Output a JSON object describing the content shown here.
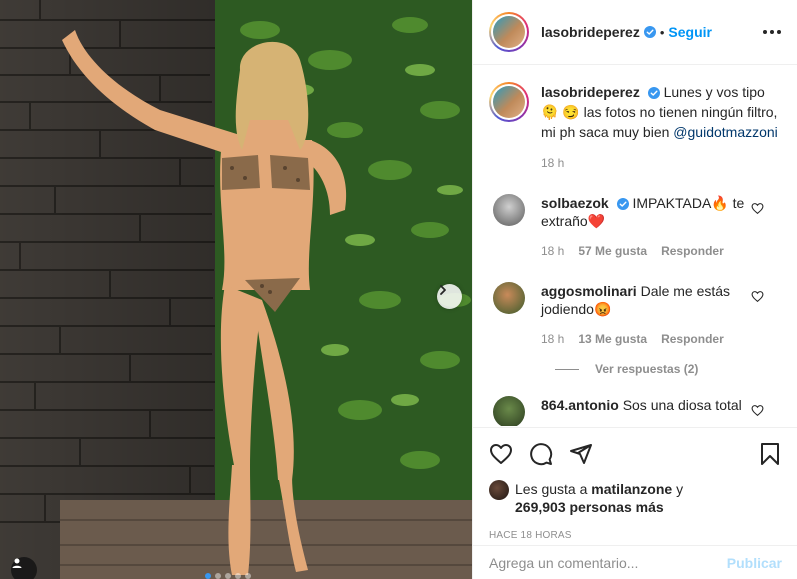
{
  "post": {
    "username": "lasobrideperez",
    "verified": true,
    "follow_label": "Seguir",
    "separator": "•",
    "more_icon": "more-options-icon"
  },
  "caption": {
    "username": "lasobrideperez",
    "text_1": "Lunes y vos tipo 🫠",
    "text_2": "😏 las fotos no tienen ningún filtro, mi ph saca muy bien",
    "mention": "@guidotmazzoni",
    "time": "18 h"
  },
  "comments": [
    {
      "username": "solbaezok",
      "verified": true,
      "text": "IMPAKTADA🔥 te extraño❤️",
      "time": "18 h",
      "likes": "57 Me gusta",
      "reply": "Responder"
    },
    {
      "username": "aggosmolinari",
      "verified": false,
      "text": "Dale me estás jodiendo😡",
      "time": "18 h",
      "likes": "13 Me gusta",
      "reply": "Responder"
    },
    {
      "username": "864.antonio",
      "verified": false,
      "text": "Sos una diosa total"
    }
  ],
  "view_replies": "Ver respuestas (2)",
  "likes": {
    "prefix": "Les gusta a",
    "user": "matilanzone",
    "joiner": "y",
    "count": "269,903 personas más"
  },
  "time_ago": "HACE 18 HORAS",
  "add_comment": {
    "placeholder": "Agrega un comentario...",
    "publish_label": "Publicar"
  },
  "carousel": {
    "slides": 5,
    "active": 1
  },
  "colors": {
    "accent": "#0095f6",
    "muted": "#8e8e8e",
    "text": "#262626",
    "publish_disabled": "#b2dffc"
  }
}
